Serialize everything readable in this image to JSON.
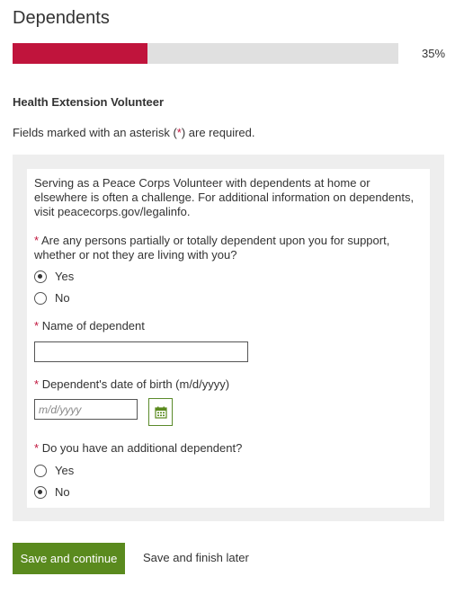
{
  "page": {
    "title": "Dependents"
  },
  "progress": {
    "percent": 35,
    "label": "35%",
    "color": "#c0143c"
  },
  "section": {
    "title": "Health Extension Volunteer"
  },
  "required_note": {
    "prefix": "Fields marked with an asterisk (",
    "asterisk": "*",
    "suffix": ") are required."
  },
  "form": {
    "intro": "Serving as a Peace Corps Volunteer with dependents at home or elsewhere is often a challenge. For additional information on dependents, visit peacecorps.gov/legalinfo.",
    "q1": {
      "asterisk": "*",
      "label": "Are any persons partially or totally dependent upon you for support, whether or not they are living with you?",
      "options": [
        {
          "label": "Yes",
          "checked": true
        },
        {
          "label": "No",
          "checked": false
        }
      ]
    },
    "dependent_name": {
      "asterisk": "*",
      "label": "Name of dependent",
      "value": ""
    },
    "dependent_dob": {
      "asterisk": "*",
      "label": "Dependent's date of birth (m/d/yyyy)",
      "placeholder": "m/d/yyyy",
      "value": ""
    },
    "q_additional": {
      "asterisk": "*",
      "label": "Do you have an additional dependent?",
      "options": [
        {
          "label": "Yes",
          "checked": false
        },
        {
          "label": "No",
          "checked": true
        }
      ]
    }
  },
  "actions": {
    "save_continue": "Save and continue",
    "save_later": "Save and finish later"
  },
  "icons": {
    "calendar": "calendar-icon"
  },
  "colors": {
    "accent_green": "#5a8a1e",
    "required_red": "#c0143c"
  }
}
